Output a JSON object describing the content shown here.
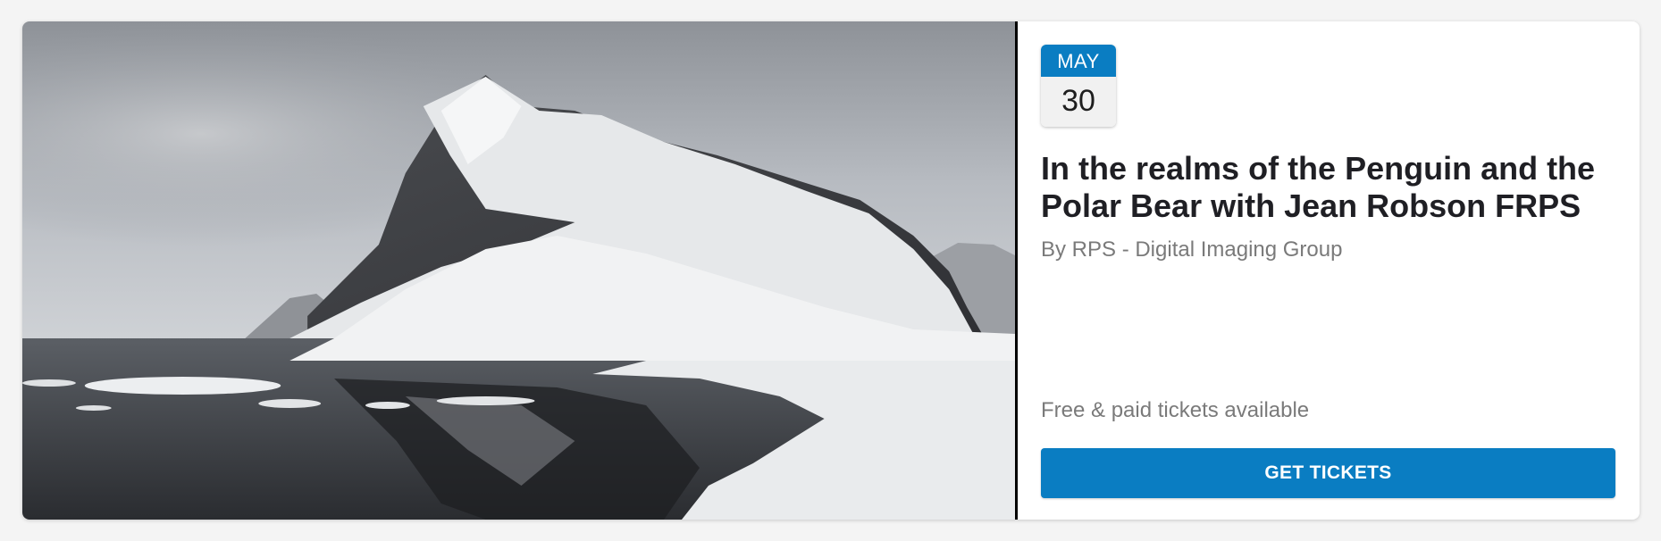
{
  "event": {
    "image_alt": "Snow-covered mountain reflected in icy polar water",
    "date": {
      "month": "MAY",
      "day": "30"
    },
    "title": "In the realms of the Penguin and the Polar Bear with Jean Robson FRPS",
    "organizer": "By RPS - Digital Imaging Group",
    "availability": "Free & paid tickets available",
    "cta_label": "GET TICKETS"
  },
  "colors": {
    "accent": "#0a7dc2",
    "title": "#1f1f24",
    "muted": "#7a7a7a"
  }
}
